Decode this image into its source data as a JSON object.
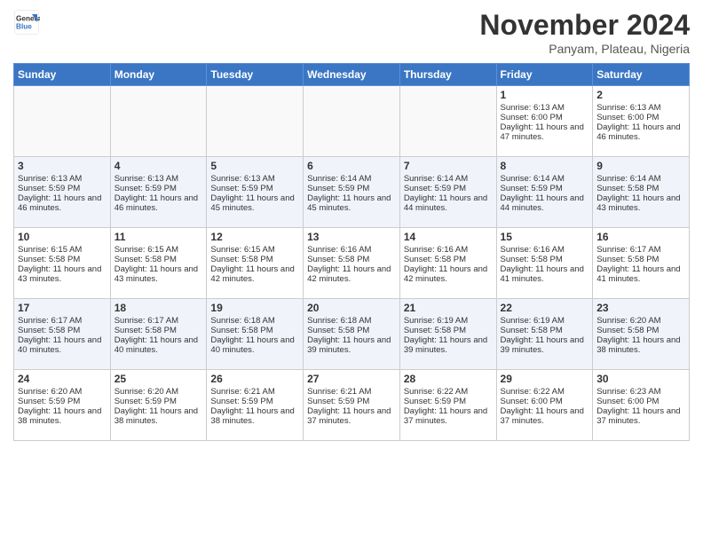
{
  "logo": {
    "line1": "General",
    "line2": "Blue"
  },
  "title": "November 2024",
  "location": "Panyam, Plateau, Nigeria",
  "days_header": [
    "Sunday",
    "Monday",
    "Tuesday",
    "Wednesday",
    "Thursday",
    "Friday",
    "Saturday"
  ],
  "weeks": [
    [
      {
        "day": "",
        "data": ""
      },
      {
        "day": "",
        "data": ""
      },
      {
        "day": "",
        "data": ""
      },
      {
        "day": "",
        "data": ""
      },
      {
        "day": "",
        "data": ""
      },
      {
        "day": "1",
        "sunrise": "Sunrise: 6:13 AM",
        "sunset": "Sunset: 6:00 PM",
        "daylight": "Daylight: 11 hours and 47 minutes."
      },
      {
        "day": "2",
        "sunrise": "Sunrise: 6:13 AM",
        "sunset": "Sunset: 6:00 PM",
        "daylight": "Daylight: 11 hours and 46 minutes."
      }
    ],
    [
      {
        "day": "3",
        "sunrise": "Sunrise: 6:13 AM",
        "sunset": "Sunset: 5:59 PM",
        "daylight": "Daylight: 11 hours and 46 minutes."
      },
      {
        "day": "4",
        "sunrise": "Sunrise: 6:13 AM",
        "sunset": "Sunset: 5:59 PM",
        "daylight": "Daylight: 11 hours and 46 minutes."
      },
      {
        "day": "5",
        "sunrise": "Sunrise: 6:13 AM",
        "sunset": "Sunset: 5:59 PM",
        "daylight": "Daylight: 11 hours and 45 minutes."
      },
      {
        "day": "6",
        "sunrise": "Sunrise: 6:14 AM",
        "sunset": "Sunset: 5:59 PM",
        "daylight": "Daylight: 11 hours and 45 minutes."
      },
      {
        "day": "7",
        "sunrise": "Sunrise: 6:14 AM",
        "sunset": "Sunset: 5:59 PM",
        "daylight": "Daylight: 11 hours and 44 minutes."
      },
      {
        "day": "8",
        "sunrise": "Sunrise: 6:14 AM",
        "sunset": "Sunset: 5:59 PM",
        "daylight": "Daylight: 11 hours and 44 minutes."
      },
      {
        "day": "9",
        "sunrise": "Sunrise: 6:14 AM",
        "sunset": "Sunset: 5:58 PM",
        "daylight": "Daylight: 11 hours and 43 minutes."
      }
    ],
    [
      {
        "day": "10",
        "sunrise": "Sunrise: 6:15 AM",
        "sunset": "Sunset: 5:58 PM",
        "daylight": "Daylight: 11 hours and 43 minutes."
      },
      {
        "day": "11",
        "sunrise": "Sunrise: 6:15 AM",
        "sunset": "Sunset: 5:58 PM",
        "daylight": "Daylight: 11 hours and 43 minutes."
      },
      {
        "day": "12",
        "sunrise": "Sunrise: 6:15 AM",
        "sunset": "Sunset: 5:58 PM",
        "daylight": "Daylight: 11 hours and 42 minutes."
      },
      {
        "day": "13",
        "sunrise": "Sunrise: 6:16 AM",
        "sunset": "Sunset: 5:58 PM",
        "daylight": "Daylight: 11 hours and 42 minutes."
      },
      {
        "day": "14",
        "sunrise": "Sunrise: 6:16 AM",
        "sunset": "Sunset: 5:58 PM",
        "daylight": "Daylight: 11 hours and 42 minutes."
      },
      {
        "day": "15",
        "sunrise": "Sunrise: 6:16 AM",
        "sunset": "Sunset: 5:58 PM",
        "daylight": "Daylight: 11 hours and 41 minutes."
      },
      {
        "day": "16",
        "sunrise": "Sunrise: 6:17 AM",
        "sunset": "Sunset: 5:58 PM",
        "daylight": "Daylight: 11 hours and 41 minutes."
      }
    ],
    [
      {
        "day": "17",
        "sunrise": "Sunrise: 6:17 AM",
        "sunset": "Sunset: 5:58 PM",
        "daylight": "Daylight: 11 hours and 40 minutes."
      },
      {
        "day": "18",
        "sunrise": "Sunrise: 6:17 AM",
        "sunset": "Sunset: 5:58 PM",
        "daylight": "Daylight: 11 hours and 40 minutes."
      },
      {
        "day": "19",
        "sunrise": "Sunrise: 6:18 AM",
        "sunset": "Sunset: 5:58 PM",
        "daylight": "Daylight: 11 hours and 40 minutes."
      },
      {
        "day": "20",
        "sunrise": "Sunrise: 6:18 AM",
        "sunset": "Sunset: 5:58 PM",
        "daylight": "Daylight: 11 hours and 39 minutes."
      },
      {
        "day": "21",
        "sunrise": "Sunrise: 6:19 AM",
        "sunset": "Sunset: 5:58 PM",
        "daylight": "Daylight: 11 hours and 39 minutes."
      },
      {
        "day": "22",
        "sunrise": "Sunrise: 6:19 AM",
        "sunset": "Sunset: 5:58 PM",
        "daylight": "Daylight: 11 hours and 39 minutes."
      },
      {
        "day": "23",
        "sunrise": "Sunrise: 6:20 AM",
        "sunset": "Sunset: 5:58 PM",
        "daylight": "Daylight: 11 hours and 38 minutes."
      }
    ],
    [
      {
        "day": "24",
        "sunrise": "Sunrise: 6:20 AM",
        "sunset": "Sunset: 5:59 PM",
        "daylight": "Daylight: 11 hours and 38 minutes."
      },
      {
        "day": "25",
        "sunrise": "Sunrise: 6:20 AM",
        "sunset": "Sunset: 5:59 PM",
        "daylight": "Daylight: 11 hours and 38 minutes."
      },
      {
        "day": "26",
        "sunrise": "Sunrise: 6:21 AM",
        "sunset": "Sunset: 5:59 PM",
        "daylight": "Daylight: 11 hours and 38 minutes."
      },
      {
        "day": "27",
        "sunrise": "Sunrise: 6:21 AM",
        "sunset": "Sunset: 5:59 PM",
        "daylight": "Daylight: 11 hours and 37 minutes."
      },
      {
        "day": "28",
        "sunrise": "Sunrise: 6:22 AM",
        "sunset": "Sunset: 5:59 PM",
        "daylight": "Daylight: 11 hours and 37 minutes."
      },
      {
        "day": "29",
        "sunrise": "Sunrise: 6:22 AM",
        "sunset": "Sunset: 6:00 PM",
        "daylight": "Daylight: 11 hours and 37 minutes."
      },
      {
        "day": "30",
        "sunrise": "Sunrise: 6:23 AM",
        "sunset": "Sunset: 6:00 PM",
        "daylight": "Daylight: 11 hours and 37 minutes."
      }
    ]
  ]
}
